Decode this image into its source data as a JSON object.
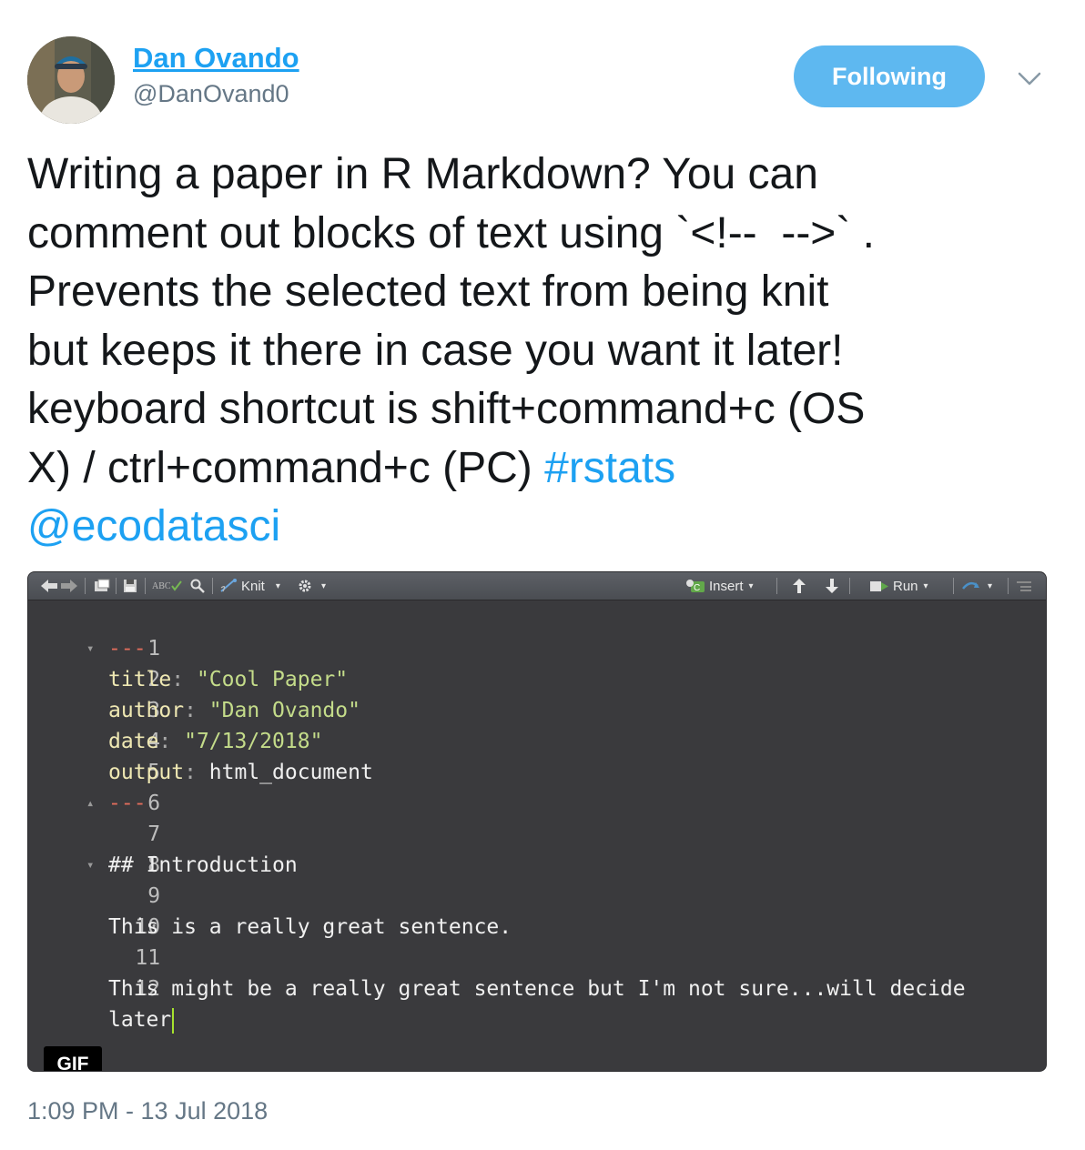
{
  "user": {
    "name": "Dan Ovando",
    "handle": "@DanOvand0",
    "follow_label": "Following"
  },
  "tweet": {
    "text_before": "Writing a paper in R Markdown? You can\ncomment out blocks of text using `<!--  -->` .\nPrevents the selected text from being knit\nbut keeps it there in case you want it later!\nkeyboard shortcut is shift+command+c (OS\nX) / ctrl+command+c (PC) ",
    "hashtag": "#rstats",
    "mention": "@ecodatasci",
    "timestamp": "1:09 PM - 13 Jul 2018"
  },
  "media": {
    "badge": "GIF",
    "toolbar": {
      "knit_label": "Knit",
      "insert_label": "Insert",
      "run_label": "Run",
      "spell_label": "ABC"
    },
    "editor": {
      "lines": [
        {
          "n": "1",
          "fold": "▾",
          "text": "---"
        },
        {
          "n": "2",
          "key": "title",
          "str": "\"Cool Paper\""
        },
        {
          "n": "3",
          "key": "author",
          "str": "\"Dan Ovando\""
        },
        {
          "n": "4",
          "key": "date",
          "str": "\"7/13/2018\""
        },
        {
          "n": "5",
          "key": "output",
          "plain": "html_document"
        },
        {
          "n": "6",
          "fold": "▴",
          "text": "---"
        },
        {
          "n": "7",
          "plain": ""
        },
        {
          "n": "8",
          "fold": "▾",
          "plain": "## Introduction"
        },
        {
          "n": "9",
          "plain": ""
        },
        {
          "n": "10",
          "plain": "This is a really great sentence."
        },
        {
          "n": "11",
          "plain": ""
        },
        {
          "n": "12",
          "plain": "This might be a really great sentence but I'm not sure...will decide"
        },
        {
          "n": "",
          "plain": "later"
        }
      ]
    }
  },
  "colors": {
    "link": "#1da1f2",
    "follow_bg": "#5eb8f0",
    "muted": "#657786",
    "editor_bg": "#3a3a3d"
  }
}
